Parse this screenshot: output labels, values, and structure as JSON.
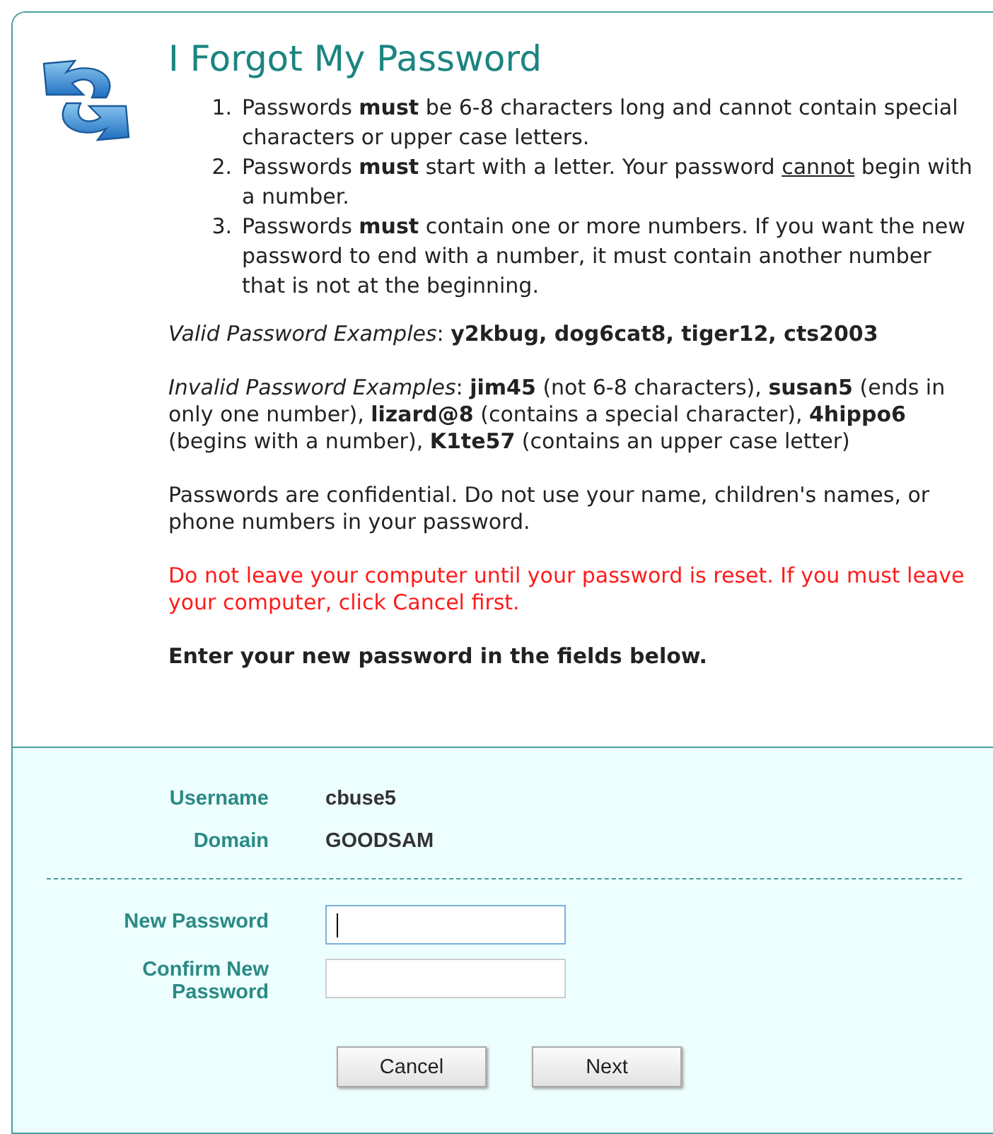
{
  "title": "I Forgot My Password",
  "rules": [
    {
      "marker": "1.",
      "text": "Passwords **must** be 6-8 characters long and cannot contain special characters or upper case letters."
    },
    {
      "marker": "2.",
      "text": "Passwords **must** start with a letter. Your password",
      "underlined": "cannot",
      "text_after": "begin with a number."
    },
    {
      "marker": "3.",
      "text": "Passwords **must** contain one or more numbers. If you want the new password to end with a number, it must contain another number that is not at the beginning."
    }
  ],
  "paragraphs": [
    {
      "kind": "normal",
      "text": "*Valid Password Examples*: **y2kbug, dog6cat8, tiger12, cts2003**"
    },
    {
      "kind": "normal",
      "text": "*Invalid Password Examples*: **jim45** (not 6-8 characters), **susan5** (ends in only one number), **lizard@8** (contains a special character), **4hippo6** (begins with a number), **K1te57** (contains an upper case letter)"
    },
    {
      "kind": "normal",
      "text": "Passwords are confidential. Do not use your name, children's names, or phone numbers in your password."
    },
    {
      "kind": "warning",
      "text": "Do not leave your computer until your password is reset. If you must leave your computer, click Cancel first."
    },
    {
      "kind": "instruction",
      "text": "Enter your new password in the fields below."
    }
  ],
  "account": [
    {
      "label": "Username",
      "value": "cbuse5"
    },
    {
      "label": "Domain",
      "value": "GOODSAM"
    }
  ],
  "fields": [
    {
      "label": "New Password",
      "focused": true
    },
    {
      "label": "Confirm New Password",
      "focused": false
    }
  ],
  "buttons": [
    "Cancel",
    "Next"
  ]
}
